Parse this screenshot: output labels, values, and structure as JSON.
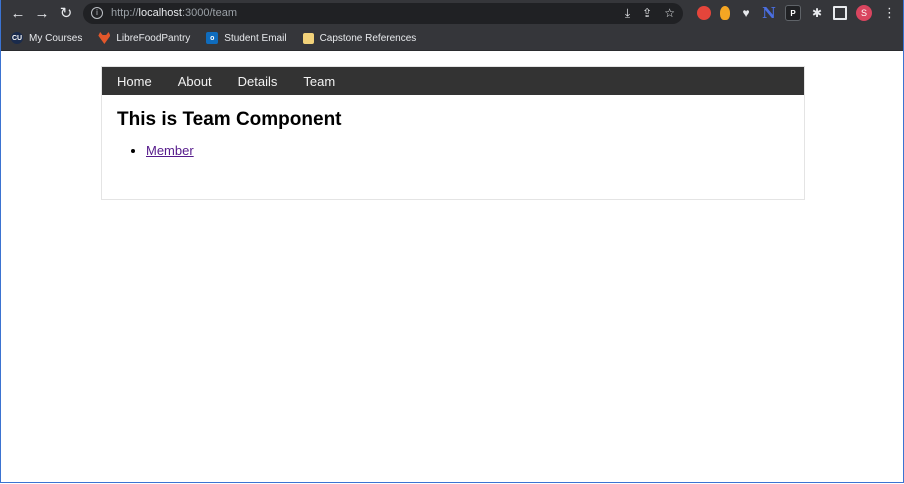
{
  "browser": {
    "url_scheme": "http://",
    "url_host": "localhost",
    "url_rest": ":3000/team",
    "profile_initial": "S",
    "icons": {
      "back": "arrow-left-icon",
      "forward": "arrow-right-icon",
      "reload": "reload-icon",
      "site_info": "info-icon",
      "install": "install-icon",
      "share": "share-icon",
      "bookmark": "star-icon",
      "extensions": "puzzle-icon",
      "side_panel": "side-panel-icon",
      "menu": "menu-dots-icon"
    },
    "extensions": [
      {
        "name": "red-extension-icon",
        "label": ""
      },
      {
        "name": "orange-extension-icon",
        "label": ""
      },
      {
        "name": "shield-extension-icon",
        "label": "♥"
      },
      {
        "name": "n-extension-icon",
        "label": "N"
      },
      {
        "name": "p-extension-icon",
        "label": "P"
      }
    ]
  },
  "bookmarks": [
    {
      "label": "My Courses",
      "icon": "CU"
    },
    {
      "label": "LibreFoodPantry",
      "icon": ""
    },
    {
      "label": "Student Email",
      "icon": "o"
    },
    {
      "label": "Capstone References",
      "icon": ""
    }
  ],
  "app": {
    "nav": [
      "Home",
      "About",
      "Details",
      "Team"
    ],
    "heading": "This is Team Component",
    "members": [
      "Member"
    ]
  },
  "colors": {
    "browser_chrome": "#35363a",
    "omnibox": "#202124",
    "navbar": "#333333",
    "link_visited": "#551a8b",
    "avatar": "#d9455f"
  }
}
